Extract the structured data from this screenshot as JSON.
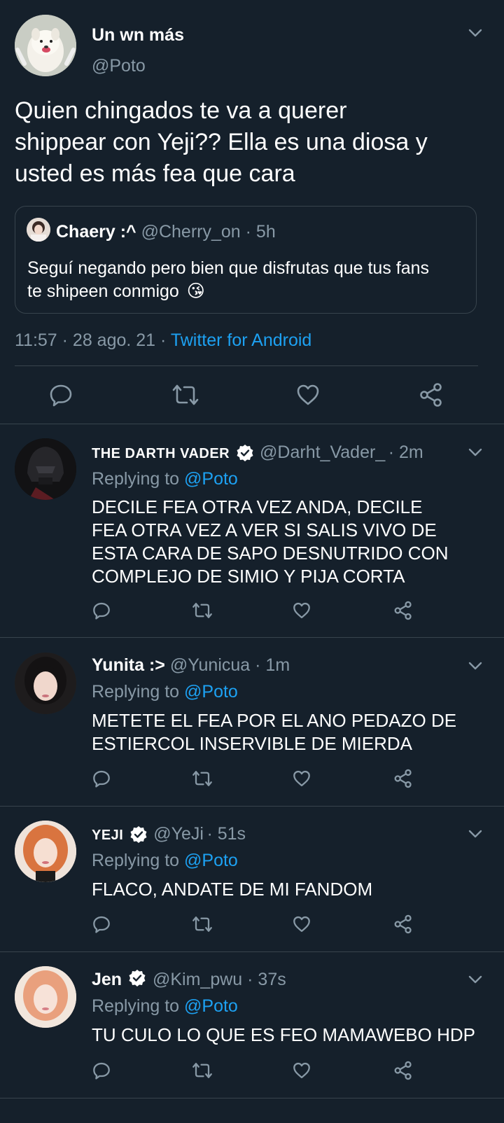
{
  "main_tweet": {
    "display_name": "Un wn más",
    "handle": "@Poto",
    "text_lines": [
      "Quien chingados te va a querer",
      "shippear con Yeji?? Ella es una diosa y",
      "usted es más fea que cara"
    ],
    "quote": {
      "display_name": "Chaery :^",
      "handle": "@Cherry_on",
      "time": "· 5h",
      "text_lines": [
        "Seguí negando pero bien que disfrutas que tus fans",
        "te shipeen conmigo"
      ],
      "emoji": "😘"
    },
    "timestamp": "11:57 · 28 ago. 21 ·",
    "source": "Twitter for Android"
  },
  "replying_to_label": "Replying to",
  "replying_to_handle": "@Poto",
  "replies": [
    {
      "display_name": "THE DARTH VADER",
      "handle": "@Darht_Vader_",
      "time": "· 2m",
      "text_lines": [
        "DECILE FEA OTRA VEZ ANDA, DECILE",
        "FEA OTRA VEZ A VER SI SALIS VIVO DE",
        "ESTA CARA DE SAPO DESNUTRIDO CON",
        "COMPLEJO DE SIMIO Y PIJA CORTA"
      ]
    },
    {
      "display_name": "Yunita :>",
      "handle": "@Yunicua",
      "time": "· 1m",
      "text_lines": [
        "METETE EL FEA POR EL ANO PEDAZO DE",
        "ESTIERCOL INSERVIBLE DE MIERDA"
      ]
    },
    {
      "display_name": "YEJI",
      "handle": "@YeJi",
      "time": "· 51s",
      "text_lines": [
        "FLACO, ANDATE DE MI FANDOM"
      ]
    },
    {
      "display_name": "Jen",
      "handle": "@Kim_pwu",
      "time": "· 37s",
      "text_lines": [
        "TU CULO LO QUE ES FEO MAMAWEBO HDP"
      ]
    }
  ],
  "colors": {
    "background": "#15202b",
    "text": "#ffffff",
    "muted": "#8899a6",
    "link": "#1da1f2",
    "divider": "#38444d"
  }
}
